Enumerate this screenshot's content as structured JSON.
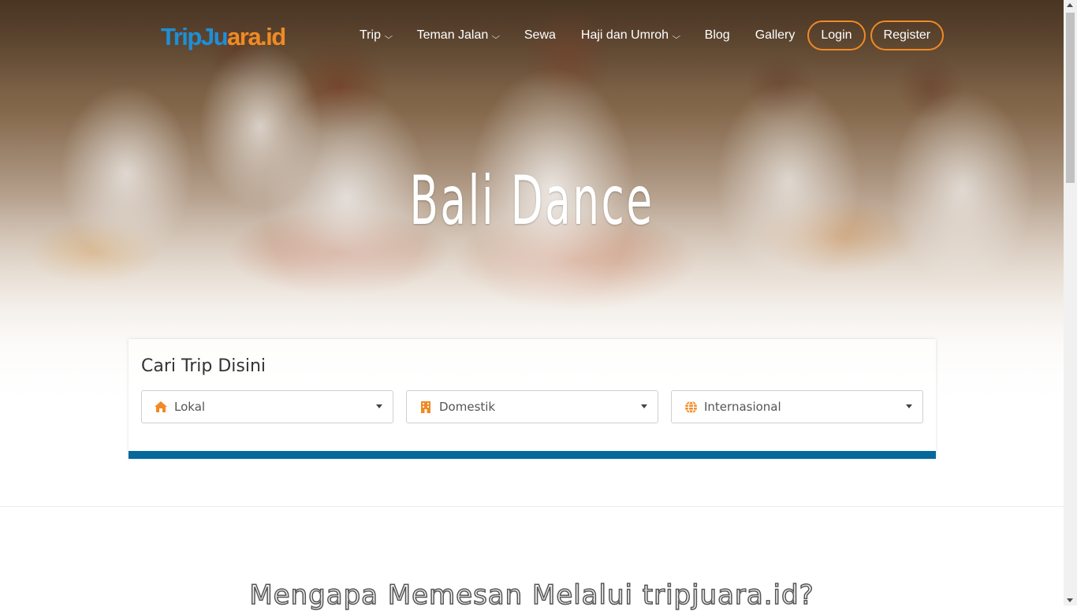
{
  "brand": {
    "logo_part1": "TripJu",
    "logo_part2": "ara.id",
    "color_primary": "#1e8fd8",
    "color_accent": "#f08a24"
  },
  "nav": {
    "items": [
      {
        "label": "Trip",
        "has_dropdown": true
      },
      {
        "label": "Teman Jalan",
        "has_dropdown": true
      },
      {
        "label": "Sewa",
        "has_dropdown": false
      },
      {
        "label": "Haji dan Umroh",
        "has_dropdown": true
      },
      {
        "label": "Blog",
        "has_dropdown": false
      },
      {
        "label": "Gallery",
        "has_dropdown": false
      }
    ],
    "login_label": "Login",
    "register_label": "Register",
    "chevron": "⌵"
  },
  "hero": {
    "title": "Bali  Dance"
  },
  "search": {
    "title": "Cari Trip Disini",
    "selects": [
      {
        "icon": "home-icon",
        "label": "Lokal"
      },
      {
        "icon": "building-icon",
        "label": "Domestik"
      },
      {
        "icon": "globe-icon",
        "label": "Internasional"
      }
    ],
    "bar_color": "#05689b"
  },
  "section": {
    "why_title": "Mengapa Memesan Melalui tripjuara.id?"
  }
}
